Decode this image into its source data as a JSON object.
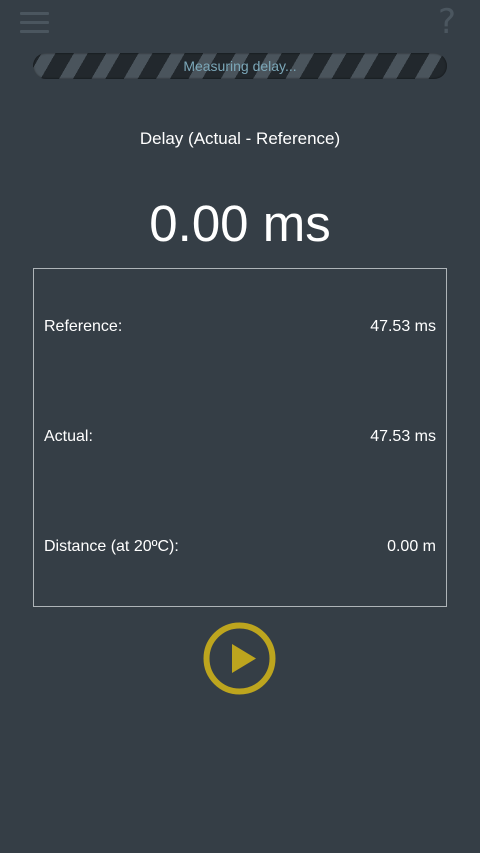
{
  "header": {
    "menu_icon": "hamburger-menu-icon",
    "help_icon": "question-mark-icon",
    "help_glyph": "?"
  },
  "progress": {
    "text": "Measuring delay..."
  },
  "delay": {
    "title": "Delay (Actual - Reference)",
    "value": "0.00 ms"
  },
  "stats": [
    {
      "label": "Reference:",
      "value": "47.53 ms"
    },
    {
      "label": "Actual:",
      "value": "47.53 ms"
    },
    {
      "label": "Distance (at 20ºC):",
      "value": "0.00 m"
    }
  ],
  "controls": {
    "play_icon": "play-icon",
    "accent_color": "#bda51e"
  },
  "colors": {
    "background": "#353e46",
    "icon_muted": "#4b565f",
    "progress_text": "#7ba7b8"
  }
}
